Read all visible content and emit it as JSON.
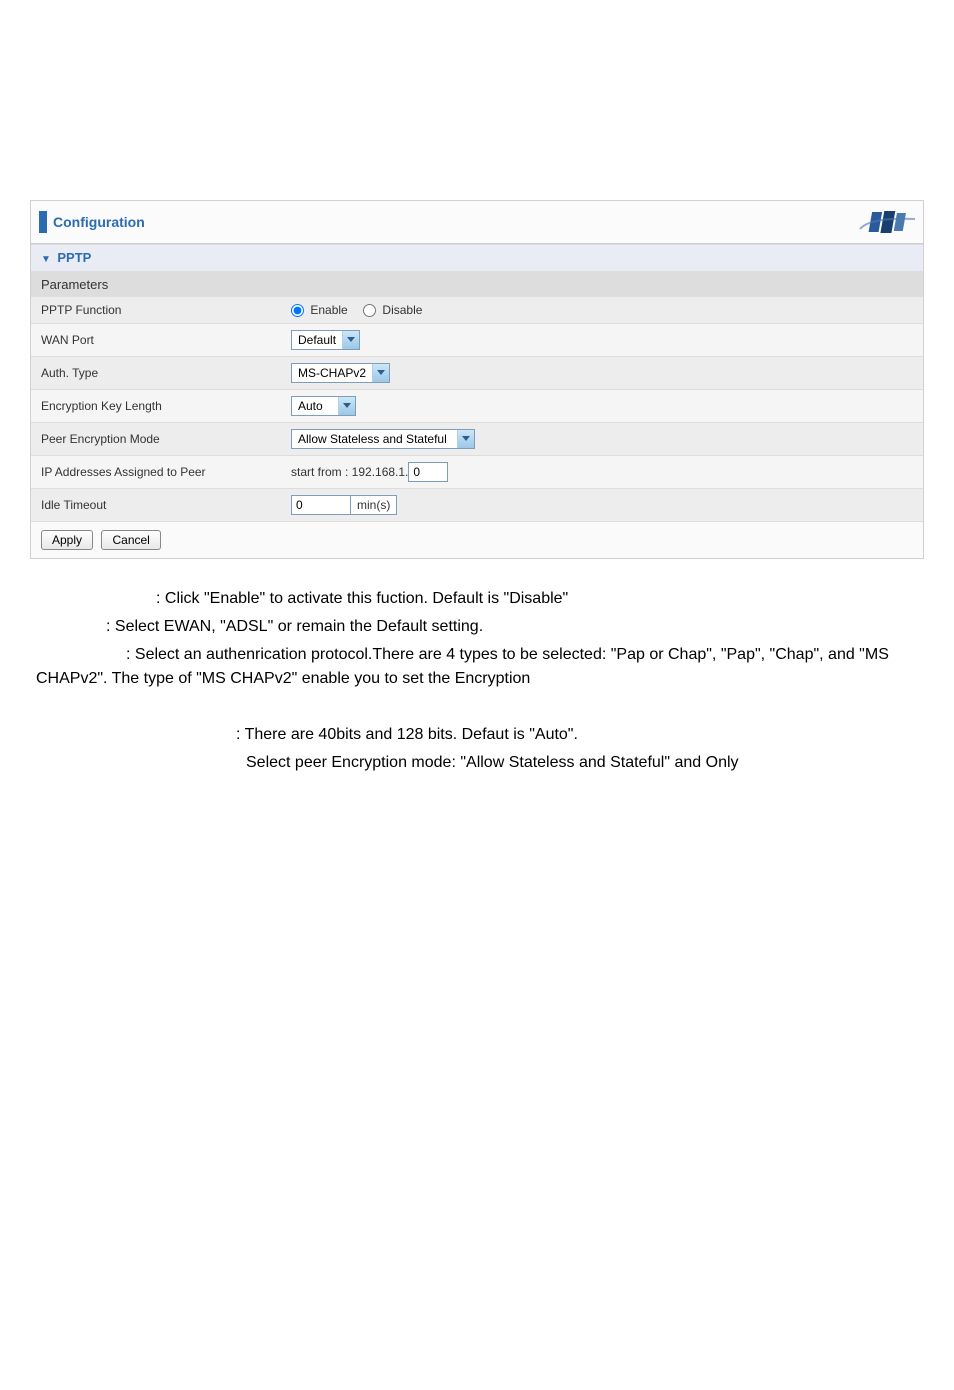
{
  "header": {
    "title": "Configuration"
  },
  "section": {
    "title": "PPTP",
    "parameters_label": "Parameters"
  },
  "fields": {
    "pptp_function": {
      "label": "PPTP Function",
      "enable": "Enable",
      "disable": "Disable"
    },
    "wan_port": {
      "label": "WAN Port",
      "value": "Default"
    },
    "auth_type": {
      "label": "Auth. Type",
      "value": "MS-CHAPv2"
    },
    "enc_key_length": {
      "label": "Encryption Key Length",
      "value": "Auto"
    },
    "peer_enc_mode": {
      "label": "Peer Encryption Mode",
      "value": "Allow Stateless and Stateful"
    },
    "ip_assigned": {
      "label": "IP Addresses Assigned to Peer",
      "prefix": "start from : 192.168.1.",
      "value": "0"
    },
    "idle_timeout": {
      "label": "Idle Timeout",
      "value": "0",
      "unit": "min(s)"
    }
  },
  "buttons": {
    "apply": "Apply",
    "cancel": "Cancel"
  },
  "desc": {
    "line1": ": Click \"Enable\" to activate this fuction. Default is \"Disable\"",
    "line2": ": Select EWAN, \"ADSL\" or remain the Default setting.",
    "line3": ": Select an authenrication protocol.There are 4 types to be selected: \"Pap or Chap\", \"Pap\", \"Chap\", and \"MS CHAPv2\". The type of \"MS CHAPv2\" enable you to set the Encryption",
    "line4": ": There are 40bits and 128 bits. Defaut is \"Auto\".",
    "line5": " Select peer Encryption mode: \"Allow Stateless and Stateful\" and Only"
  }
}
